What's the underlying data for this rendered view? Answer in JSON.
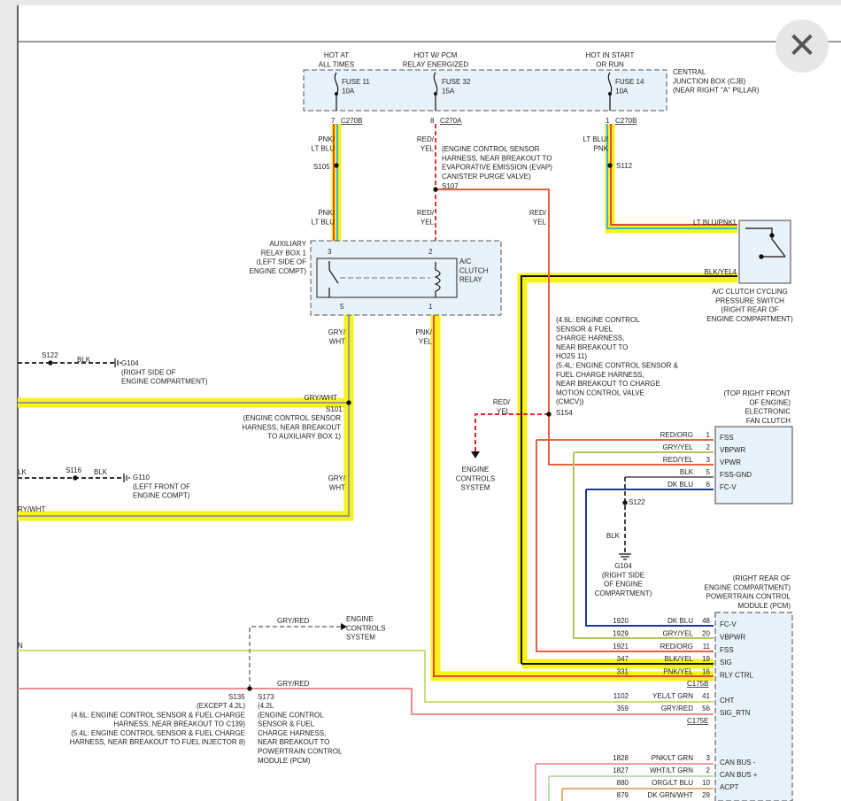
{
  "close": {
    "glyph": "✕",
    "icon": "close-icon"
  },
  "cjb": {
    "label": [
      "CENTRAL",
      "JUNCTION BOX (CJB)",
      "(NEAR RIGHT \"A\" PILLAR)"
    ],
    "hot1": [
      "HOT AT",
      "ALL TIMES"
    ],
    "hot2": [
      "HOT W/ PCM",
      "RELAY ENERGIZED"
    ],
    "hot3": [
      "HOT IN START",
      "OR RUN"
    ],
    "fuse1": [
      "FUSE 11",
      "10A"
    ],
    "fuse2": [
      "FUSE 32",
      "15A"
    ],
    "fuse3": [
      "FUSE 14",
      "10A"
    ],
    "pin1": "7",
    "conn1": "C270B",
    "pin2": "8",
    "conn2": "C270A",
    "pin3": "1",
    "conn3": "C270B"
  },
  "wires": {
    "pnk_ltblu_1": [
      "PNK/",
      "LT BLU"
    ],
    "pnk_ltblu_2": [
      "PNK/",
      "LT BLU"
    ],
    "red_yel_1": [
      "RED/",
      "YEL"
    ],
    "red_yel_2": [
      "RED/",
      "YEL"
    ],
    "red_yel_3": [
      "RED/",
      "YEL"
    ],
    "red_yel_4": [
      "RED/",
      "YEL"
    ],
    "ltblu_pnk_1": [
      "LT BLU/",
      "PNK"
    ],
    "ltblu_pnk_2": "LT BLU/PNK",
    "blk_yel": "BLK/YEL",
    "gry_wht_1": [
      "GRY/",
      "WHT"
    ],
    "gry_wht_2": "GRY/WHT",
    "gry_wht_3": [
      "GRY/",
      "WHT"
    ],
    "gry_wht_4": "RY/WHT",
    "pnk_yel": [
      "PNK/",
      "YEL"
    ],
    "blk_1": "BLK",
    "blk_2": "BLK",
    "blk_3": "LK",
    "blk_4": "BLK",
    "gry_red_1": "GRY/RED",
    "gry_red_2": "GRY/RED",
    "n_edge": "N"
  },
  "splices": {
    "s105": "S105",
    "s107": "S107",
    "s112": "S112",
    "s122": "S122",
    "s101": "S101",
    "s116": "S116",
    "s154": "S154",
    "s122b": "S122",
    "s135": "S135",
    "s173": "S173"
  },
  "notes": {
    "s107": [
      "(ENGINE CONTROL SENSOR",
      "HARNESS, NEAR BREAKOUT TO",
      "EVAPORATIVE EMISSION (EVAP)",
      "CANISTER PURGE VALVE)"
    ],
    "s101": [
      "(ENGINE CONTROL SENSOR",
      "HARNESS, NEAR BREAKOUT",
      "TO AUXILIARY BOX 1)"
    ],
    "s154": [
      "(4.6L: ENGINE CONTROL",
      "SENSOR & FUEL",
      "CHARGE HARNESS,",
      "NEAR BREAKOUT TO",
      "HO2S 11)",
      "(5.4L: ENGINE CONTROL SENSOR &",
      "FUEL CHARGE HARNESS,",
      "NEAR BREAKOUT TO CHARGE",
      "MOTION CONTROL VALVE",
      "(CMCV))"
    ],
    "s135": [
      "(EXCEPT 4.2L)",
      "(4.6L: ENGINE CONTROL SENSOR & FUEL CHARGE",
      "HARNESS, NEAR BREAKOUT TO C139)",
      "(5.4L: ENGINE CONTROL SENSOR & FUEL CHARGE",
      "HARNESS, NEAR BREAKOUT TO FUEL INJECTOR 8)"
    ],
    "s173": [
      "(4.2L",
      "(ENGINE CONTROL",
      "SENSOR & FUEL",
      "CHARGE HARNESS,",
      "NEAR BREAKOUT TO",
      "POWERTRAIN CONTROL",
      "MODULE (PCM)"
    ],
    "ecs1": [
      "ENGINE",
      "CONTROLS",
      "SYSTEM"
    ],
    "ecs2": [
      "ENGINE",
      "CONTROLS",
      "SYSTEM"
    ]
  },
  "grounds": {
    "g104a": [
      "G104",
      "(RIGHT SIDE OF",
      "ENGINE COMPARTMENT)"
    ],
    "g110": [
      "G110",
      "(LEFT FRONT OF",
      "ENGINE COMPT)"
    ],
    "g104b": [
      "G104",
      "(RIGHT SIDE",
      "OF ENGINE",
      "COMPARTMENT)"
    ]
  },
  "relay": {
    "label": [
      "AUXILIARY",
      "RELAY BOX 1",
      "(LEFT SIDE OF",
      "ENGINE COMPT)"
    ],
    "name": [
      "A/C",
      "CLUTCH",
      "RELAY"
    ],
    "pin3": "3",
    "pin2": "2",
    "pin5": "5",
    "pin1": "1"
  },
  "pressure_switch": {
    "label": [
      "A/C CLUTCH CYCLING",
      "PRESSURE SWITCH",
      "(RIGHT REAR OF",
      "ENGINE COMPARTMENT)"
    ],
    "pin1": "1",
    "pin4": "4"
  },
  "fan_clutch": {
    "label": [
      "(TOP RIGHT FRONT",
      "OF ENGINE)",
      "ELECTRONIC",
      "FAN CLUTCH"
    ],
    "rows": [
      {
        "wire": "RED/ORG",
        "pin": "1",
        "name": "FSS"
      },
      {
        "wire": "GRY/YEL",
        "pin": "2",
        "name": "VBPWR"
      },
      {
        "wire": "RED/YEL",
        "pin": "3",
        "name": "VPWR"
      },
      {
        "wire": "BLK",
        "pin": "5",
        "name": "FSS-GND"
      },
      {
        "wire": "DK BLU",
        "pin": "6",
        "name": "FC-V"
      }
    ]
  },
  "pcm": {
    "label": [
      "(RIGHT REAR OF",
      "ENGINE COMPARTMENT)",
      "POWERTRAIN CONTROL",
      "MODULE (PCM)"
    ],
    "rows": [
      {
        "circuit": "1920",
        "wire": "DK BLU",
        "pin": "48",
        "name": "FC-V"
      },
      {
        "circuit": "1929",
        "wire": "GRY/YEL",
        "pin": "20",
        "name": "VBPWR"
      },
      {
        "circuit": "1921",
        "wire": "RED/ORG",
        "pin": "11",
        "name": "FSS"
      },
      {
        "circuit": "347",
        "wire": "BLK/YEL",
        "pin": "19",
        "name": "SIG"
      },
      {
        "circuit": "331",
        "wire": "PNK/YEL",
        "pin": "16",
        "name": "RLY CTRL"
      }
    ],
    "conn1": "C175B",
    "rows2": [
      {
        "circuit": "1102",
        "wire": "YEL/LT GRN",
        "pin": "41",
        "name": "CHT"
      },
      {
        "circuit": "359",
        "wire": "GRY/RED",
        "pin": "56",
        "name": "SIG_RTN"
      }
    ],
    "conn2": "C175E",
    "rows3": [
      {
        "circuit": "1828",
        "wire": "PNK/LT GRN",
        "pin": "3",
        "name": "CAN BUS -"
      },
      {
        "circuit": "1827",
        "wire": "WHT/LT GRN",
        "pin": "2",
        "name": "CAN BUS +"
      },
      {
        "circuit": "880",
        "wire": "ORG/LT BLU",
        "pin": "10",
        "name": "ACPT"
      },
      {
        "circuit": "879",
        "wire": "DK GRN/WHT",
        "pin": "29",
        "name": ""
      }
    ]
  }
}
